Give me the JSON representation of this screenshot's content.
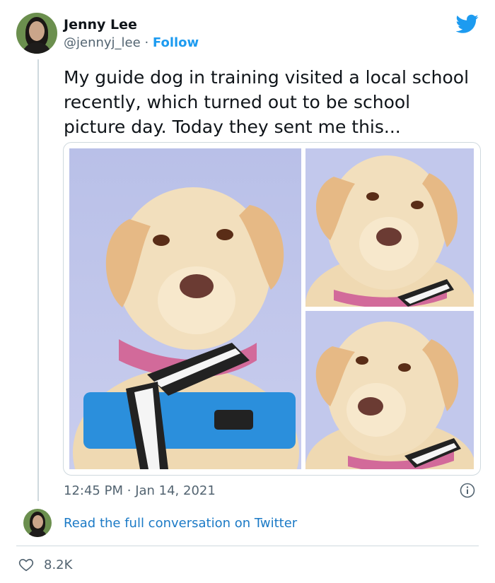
{
  "author": {
    "name": "Jenny Lee",
    "handle": "@jennyj_lee",
    "separator": "·",
    "follow_label": "Follow"
  },
  "brand": {
    "icon": "twitter-bird-icon",
    "color": "#1d9bf0"
  },
  "tweet": {
    "text_lines": [
      "My guide dog in training visited a local school",
      "recently, which turned out to be school",
      "picture day. Today they sent me this..."
    ]
  },
  "media": {
    "photos": [
      {
        "name": "dog-photo-large"
      },
      {
        "name": "dog-photo-top-right"
      },
      {
        "name": "dog-photo-bottom-right"
      }
    ]
  },
  "meta": {
    "time": "12:45 PM",
    "separator": "·",
    "date": "Jan 14, 2021",
    "info_icon": "info-icon"
  },
  "conversation": {
    "link_label": "Read the full conversation on Twitter"
  },
  "actions": {
    "like_icon": "heart-icon",
    "like_count": "8.2K"
  },
  "colors": {
    "accent": "#1d9bf0",
    "text": "#0f1419",
    "muted": "#536471",
    "border": "#cfd9de"
  }
}
